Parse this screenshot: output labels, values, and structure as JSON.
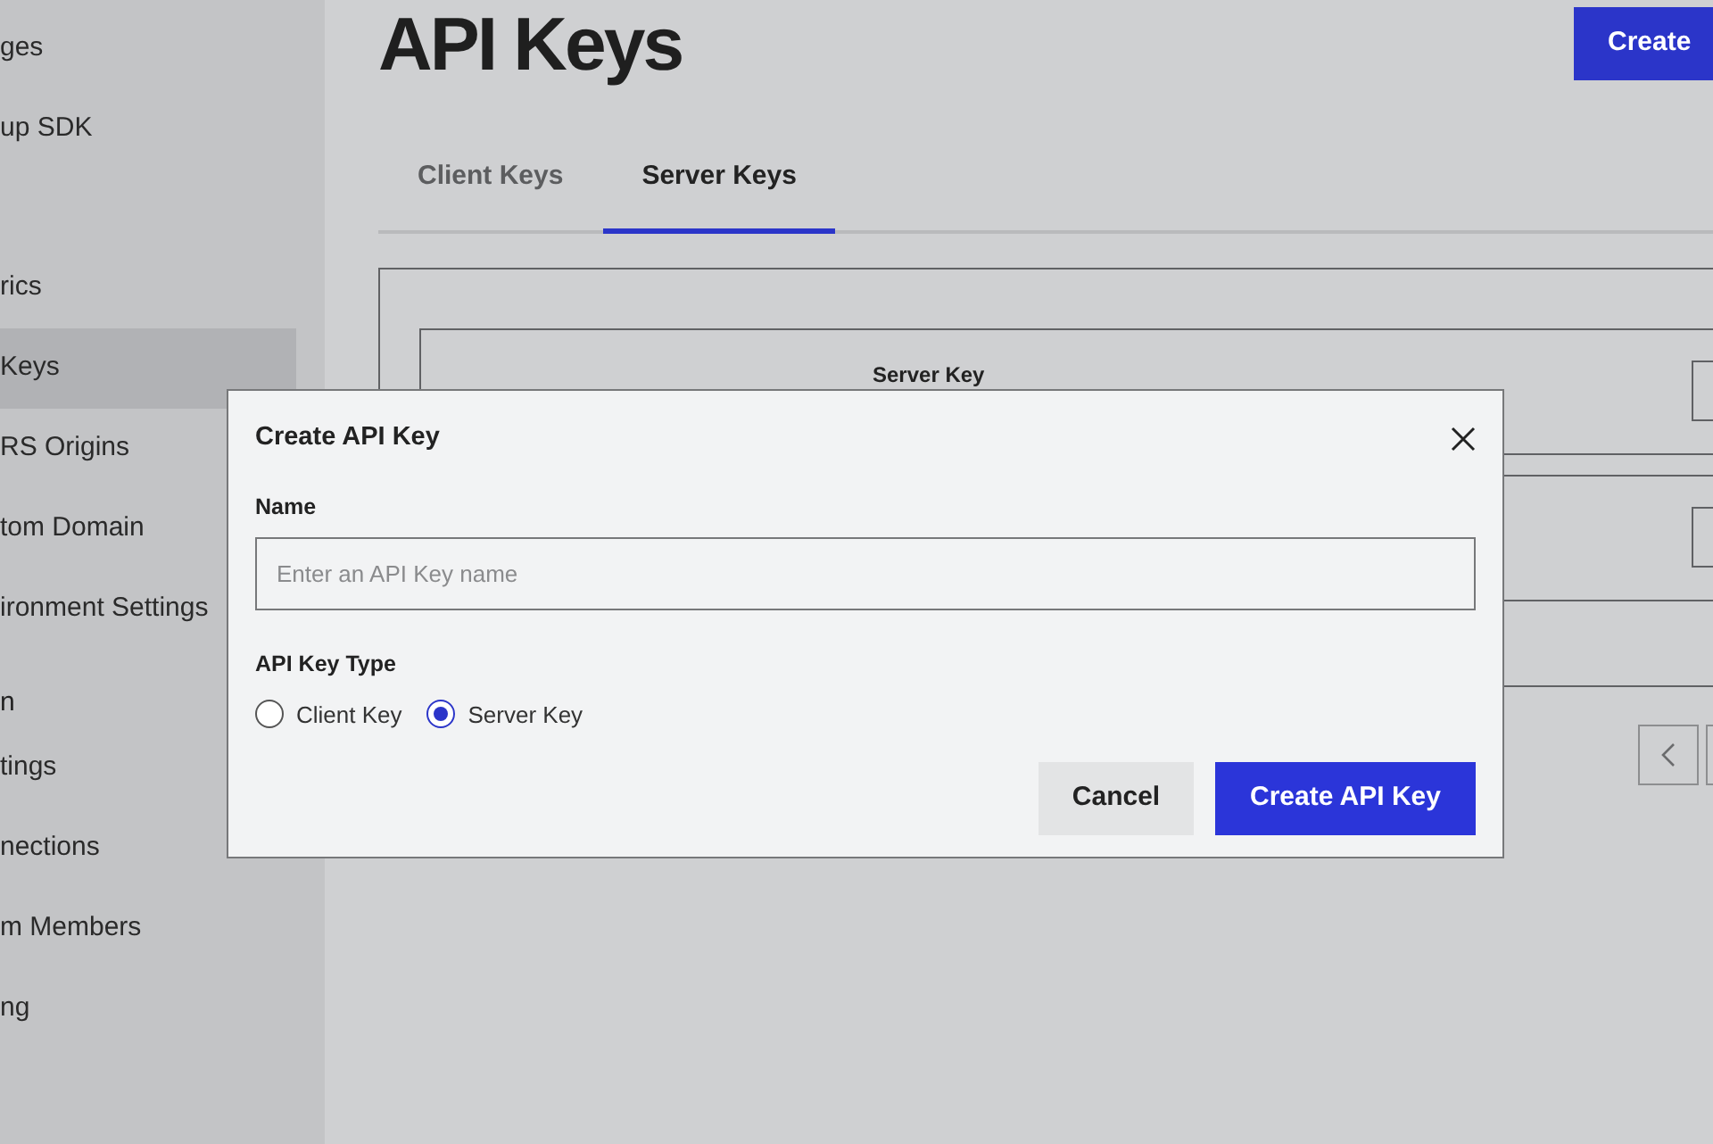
{
  "sidebar": {
    "groups": [
      {
        "items": [
          {
            "label": "ges",
            "selected": false
          },
          {
            "label": "up SDK",
            "selected": false
          }
        ]
      },
      {
        "items": [
          {
            "label": "rics",
            "selected": false
          },
          {
            "label": "Keys",
            "selected": true
          },
          {
            "label": "RS Origins",
            "selected": false
          },
          {
            "label": "tom Domain",
            "selected": false
          },
          {
            "label": "ironment Settings",
            "selected": false
          }
        ]
      },
      {
        "heading": "n",
        "items": [
          {
            "label": "tings",
            "selected": false
          },
          {
            "label": "nections",
            "selected": false
          },
          {
            "label": "m Members",
            "selected": false
          },
          {
            "label": "ng",
            "selected": false
          }
        ]
      }
    ]
  },
  "page": {
    "title": "API Keys",
    "create_button": "Create"
  },
  "tabs": [
    {
      "label": "Client Keys",
      "selected": false
    },
    {
      "label": "Server Keys",
      "selected": true
    }
  ],
  "table": {
    "columns": [
      "Server Key"
    ]
  },
  "modal": {
    "title": "Create API Key",
    "name_label": "Name",
    "name_placeholder": "Enter an API Key name",
    "type_label": "API Key Type",
    "types": [
      {
        "label": "Client Key",
        "selected": false
      },
      {
        "label": "Server Key",
        "selected": true
      }
    ],
    "buttons": [
      {
        "label": "Cancel",
        "kind": "secondary"
      },
      {
        "label": "Create API Key",
        "kind": "primary"
      }
    ]
  }
}
